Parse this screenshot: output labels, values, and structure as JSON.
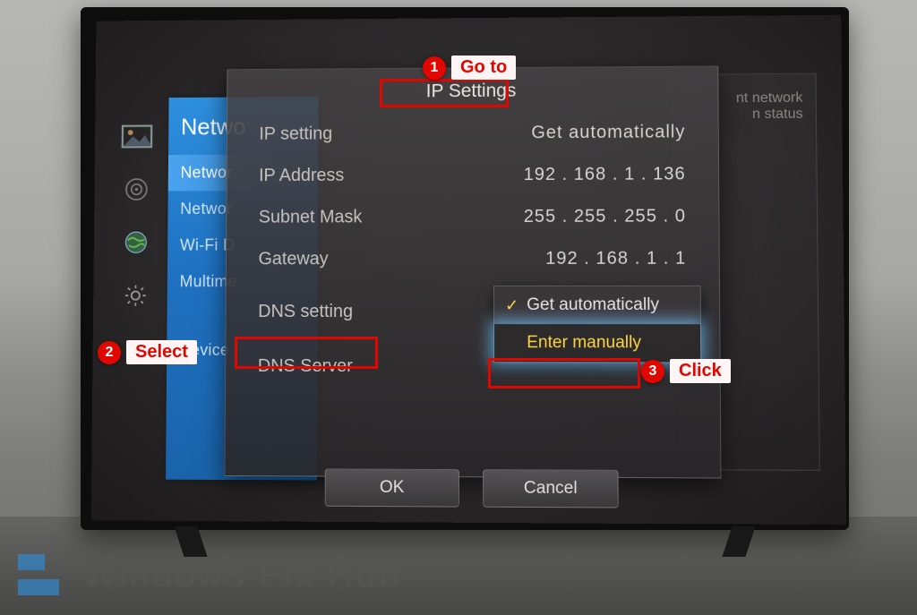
{
  "panel": {
    "title": "Netwo",
    "items": [
      "Networ",
      "Networ",
      "Wi-Fi D",
      "Multime",
      "Device I"
    ],
    "selected_index": 0
  },
  "dialog": {
    "title": "IP Settings",
    "rows": [
      {
        "label": "IP setting",
        "value": "Get automatically"
      },
      {
        "label": "IP Address",
        "value": "192 . 168 . 1 . 136"
      },
      {
        "label": "Subnet Mask",
        "value": "255 . 255 . 255 . 0"
      },
      {
        "label": "Gateway",
        "value": "192 . 168 . 1 . 1"
      }
    ],
    "dns_label": "DNS setting",
    "dns_server_label": "DNS Server",
    "options": {
      "auto": "Get automatically",
      "manual": "Enter manually"
    },
    "ok": "OK",
    "cancel": "Cancel"
  },
  "status_panel": {
    "line1": "nt network",
    "line2": "n status"
  },
  "annotations": {
    "a1": {
      "num": "1",
      "text": "Go to"
    },
    "a2": {
      "num": "2",
      "text": "Select"
    },
    "a3": {
      "num": "3",
      "text": "Click"
    }
  },
  "watermark": "Windows Fix Hub",
  "icons": [
    "picture",
    "target",
    "globe",
    "gear",
    "help"
  ]
}
